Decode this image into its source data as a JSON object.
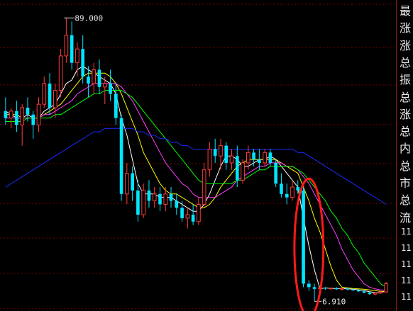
{
  "chart_data": {
    "type": "candlestick",
    "annotations": {
      "high_label": "89.000",
      "low_label": "6.910"
    },
    "price_range": [
      6.91,
      89.0
    ],
    "colors": {
      "up_candle": "#ff3b3b",
      "down_candle": "#00e5ff",
      "grid": "#7a0000",
      "ma1": "#ffffff",
      "ma2": "#ffff00",
      "ma3": "#ff40ff",
      "ma4": "#00ff00",
      "ma5": "#1a2aff",
      "highlight_ellipse": "#ff1a1a"
    },
    "candles": [
      {
        "o": 62,
        "h": 66,
        "l": 58,
        "c": 60
      },
      {
        "o": 60,
        "h": 63,
        "l": 57,
        "c": 62
      },
      {
        "o": 62,
        "h": 65,
        "l": 56,
        "c": 58
      },
      {
        "o": 58,
        "h": 64,
        "l": 52,
        "c": 63
      },
      {
        "o": 63,
        "h": 66,
        "l": 59,
        "c": 61
      },
      {
        "o": 61,
        "h": 62,
        "l": 54,
        "c": 58
      },
      {
        "o": 58,
        "h": 66,
        "l": 56,
        "c": 64
      },
      {
        "o": 64,
        "h": 72,
        "l": 63,
        "c": 70
      },
      {
        "o": 70,
        "h": 73,
        "l": 61,
        "c": 63
      },
      {
        "o": 63,
        "h": 70,
        "l": 60,
        "c": 68
      },
      {
        "o": 68,
        "h": 80,
        "l": 66,
        "c": 78
      },
      {
        "o": 78,
        "h": 89,
        "l": 76,
        "c": 84
      },
      {
        "o": 84,
        "h": 88,
        "l": 74,
        "c": 76
      },
      {
        "o": 76,
        "h": 82,
        "l": 72,
        "c": 80
      },
      {
        "o": 80,
        "h": 84,
        "l": 70,
        "c": 72
      },
      {
        "o": 72,
        "h": 75,
        "l": 66,
        "c": 70
      },
      {
        "o": 70,
        "h": 76,
        "l": 67,
        "c": 74
      },
      {
        "o": 74,
        "h": 77,
        "l": 67,
        "c": 69
      },
      {
        "o": 69,
        "h": 72,
        "l": 64,
        "c": 70
      },
      {
        "o": 70,
        "h": 74,
        "l": 65,
        "c": 67
      },
      {
        "o": 67,
        "h": 70,
        "l": 58,
        "c": 60
      },
      {
        "o": 60,
        "h": 61,
        "l": 36,
        "c": 38
      },
      {
        "o": 38,
        "h": 47,
        "l": 35,
        "c": 44
      },
      {
        "o": 44,
        "h": 46,
        "l": 36,
        "c": 39
      },
      {
        "o": 39,
        "h": 42,
        "l": 30,
        "c": 32
      },
      {
        "o": 32,
        "h": 41,
        "l": 31,
        "c": 39
      },
      {
        "o": 39,
        "h": 42,
        "l": 34,
        "c": 36
      },
      {
        "o": 36,
        "h": 40,
        "l": 34,
        "c": 38
      },
      {
        "o": 38,
        "h": 40,
        "l": 33,
        "c": 35
      },
      {
        "o": 35,
        "h": 40,
        "l": 33,
        "c": 38
      },
      {
        "o": 38,
        "h": 40,
        "l": 34,
        "c": 36
      },
      {
        "o": 36,
        "h": 38,
        "l": 32,
        "c": 34
      },
      {
        "o": 34,
        "h": 36,
        "l": 30,
        "c": 31
      },
      {
        "o": 31,
        "h": 34,
        "l": 28,
        "c": 32
      },
      {
        "o": 32,
        "h": 35,
        "l": 29,
        "c": 30
      },
      {
        "o": 30,
        "h": 37,
        "l": 29,
        "c": 35
      },
      {
        "o": 35,
        "h": 47,
        "l": 34,
        "c": 45
      },
      {
        "o": 45,
        "h": 53,
        "l": 43,
        "c": 51
      },
      {
        "o": 51,
        "h": 54,
        "l": 47,
        "c": 49
      },
      {
        "o": 49,
        "h": 54,
        "l": 45,
        "c": 52
      },
      {
        "o": 52,
        "h": 53,
        "l": 45,
        "c": 47
      },
      {
        "o": 47,
        "h": 51,
        "l": 45,
        "c": 49
      },
      {
        "o": 49,
        "h": 52,
        "l": 40,
        "c": 42
      },
      {
        "o": 42,
        "h": 48,
        "l": 41,
        "c": 47
      },
      {
        "o": 47,
        "h": 52,
        "l": 45,
        "c": 50
      },
      {
        "o": 50,
        "h": 51,
        "l": 46,
        "c": 48
      },
      {
        "o": 48,
        "h": 51,
        "l": 45,
        "c": 47
      },
      {
        "o": 47,
        "h": 51,
        "l": 46,
        "c": 50
      },
      {
        "o": 50,
        "h": 51,
        "l": 46,
        "c": 47
      },
      {
        "o": 47,
        "h": 48,
        "l": 40,
        "c": 41
      },
      {
        "o": 41,
        "h": 44,
        "l": 37,
        "c": 38
      },
      {
        "o": 38,
        "h": 41,
        "l": 35,
        "c": 37
      },
      {
        "o": 37,
        "h": 42,
        "l": 36,
        "c": 40
      },
      {
        "o": 40,
        "h": 42,
        "l": 38,
        "c": 39
      },
      {
        "o": 39,
        "h": 40,
        "l": 11,
        "c": 12
      },
      {
        "o": 12,
        "h": 13,
        "l": 10,
        "c": 11
      },
      {
        "o": 11,
        "h": 12,
        "l": 6.91,
        "c": 10.5
      },
      {
        "o": 10.5,
        "h": 11.2,
        "l": 10,
        "c": 10.8
      },
      {
        "o": 10.8,
        "h": 11,
        "l": 10.2,
        "c": 10.6
      },
      {
        "o": 10.6,
        "h": 11,
        "l": 10.3,
        "c": 10.7
      },
      {
        "o": 10.7,
        "h": 11,
        "l": 10.2,
        "c": 10.4
      },
      {
        "o": 10.4,
        "h": 10.8,
        "l": 10,
        "c": 10.6
      },
      {
        "o": 10.6,
        "h": 10.8,
        "l": 10.1,
        "c": 10.3
      },
      {
        "o": 10.3,
        "h": 10.6,
        "l": 9.8,
        "c": 10.1
      },
      {
        "o": 10.1,
        "h": 10.4,
        "l": 9.6,
        "c": 9.8
      },
      {
        "o": 9.8,
        "h": 10.2,
        "l": 9.2,
        "c": 9.4
      },
      {
        "o": 9.4,
        "h": 9.8,
        "l": 8.8,
        "c": 9.0
      },
      {
        "o": 9.0,
        "h": 9.6,
        "l": 8.6,
        "c": 9.3
      },
      {
        "o": 9.3,
        "h": 9.8,
        "l": 9.0,
        "c": 9.6
      },
      {
        "o": 9.6,
        "h": 12.5,
        "l": 9.4,
        "c": 12.0
      }
    ],
    "moving_averages": [
      {
        "name": "ma1",
        "values": [
          62,
          61,
          60,
          60,
          61,
          60,
          60,
          62,
          63,
          64,
          67,
          70,
          71,
          74,
          75,
          74,
          73,
          72,
          71,
          70,
          67,
          60,
          55,
          48,
          41,
          38,
          38,
          38,
          37,
          37,
          37,
          36,
          35,
          34,
          33,
          33,
          35,
          38,
          42,
          46,
          49,
          49,
          48,
          46,
          46,
          47,
          48,
          48,
          49,
          48,
          46,
          44,
          42,
          40,
          31,
          23,
          16,
          10.5,
          10.8,
          10.6,
          10.6,
          10.6,
          10.5,
          10.4,
          10.2,
          10.0,
          9.7,
          9.4,
          9.3,
          10.0
        ]
      },
      {
        "name": "ma2",
        "values": [
          61,
          61,
          61,
          60,
          60,
          60,
          60,
          61,
          62,
          63,
          64,
          66,
          68,
          70,
          72,
          73,
          73,
          73,
          73,
          72,
          70,
          67,
          63,
          59,
          55,
          50,
          47,
          44,
          41,
          39,
          38,
          38,
          37,
          36,
          35,
          34,
          34,
          35,
          37,
          40,
          42,
          44,
          46,
          47,
          48,
          48,
          48,
          48,
          48,
          48,
          47,
          46,
          45,
          44,
          40,
          36,
          31,
          27,
          22,
          17,
          13,
          11,
          10.8,
          10.6,
          10.5,
          10.4,
          10.2,
          10.0,
          9.8,
          9.8
        ]
      },
      {
        "name": "ma3",
        "values": [
          60,
          60,
          60,
          60,
          60,
          60,
          60,
          61,
          61,
          62,
          63,
          64,
          65,
          67,
          68,
          69,
          70,
          70,
          70,
          70,
          70,
          69,
          67,
          65,
          62,
          59,
          56,
          53,
          50,
          47,
          45,
          43,
          41,
          40,
          38,
          37,
          37,
          37,
          37,
          38,
          39,
          40,
          42,
          43,
          44,
          45,
          46,
          46,
          47,
          47,
          47,
          46,
          46,
          45,
          43,
          41,
          38,
          35,
          32,
          29,
          26,
          22,
          19,
          16,
          14,
          12,
          11,
          10.5,
          10.2,
          10.1
        ]
      },
      {
        "name": "ma4",
        "values": [
          59,
          59,
          59,
          59,
          60,
          60,
          60,
          60,
          60,
          61,
          61,
          62,
          63,
          64,
          65,
          66,
          67,
          67,
          68,
          68,
          68,
          68,
          67,
          66,
          64,
          62,
          60,
          58,
          56,
          54,
          52,
          50,
          48,
          46,
          44,
          42,
          41,
          41,
          41,
          41,
          41,
          41,
          42,
          42,
          43,
          44,
          45,
          45,
          46,
          46,
          46,
          46,
          46,
          45,
          44,
          42,
          40,
          38,
          36,
          33,
          31,
          28,
          26,
          23,
          21,
          18,
          16,
          14,
          12,
          11
        ]
      },
      {
        "name": "ma5",
        "values": [
          40,
          41,
          42,
          43,
          44,
          45,
          46,
          47,
          48,
          49,
          50,
          51,
          52,
          53,
          54,
          55,
          56,
          56,
          57,
          57,
          57,
          57,
          57,
          57,
          56,
          56,
          55,
          55,
          54,
          54,
          53,
          53,
          52,
          52,
          51,
          51,
          51,
          51,
          51,
          51,
          51,
          51,
          51,
          51,
          51,
          51,
          51,
          51,
          51,
          51,
          51,
          51,
          51,
          50,
          50,
          49,
          48,
          47,
          46,
          45,
          44,
          43,
          42,
          41,
          40,
          39,
          38,
          37,
          36,
          35
        ]
      }
    ],
    "highlight_ellipse": {
      "from_index": 54,
      "to_index": 56
    }
  },
  "sidebar": {
    "labels": [
      "最",
      "涨",
      "涨",
      "总",
      "振",
      "总",
      "涨",
      "总",
      "内",
      "总",
      "市",
      "总",
      "流"
    ],
    "numbers": [
      "11",
      "11",
      "11",
      "11",
      "11"
    ]
  }
}
